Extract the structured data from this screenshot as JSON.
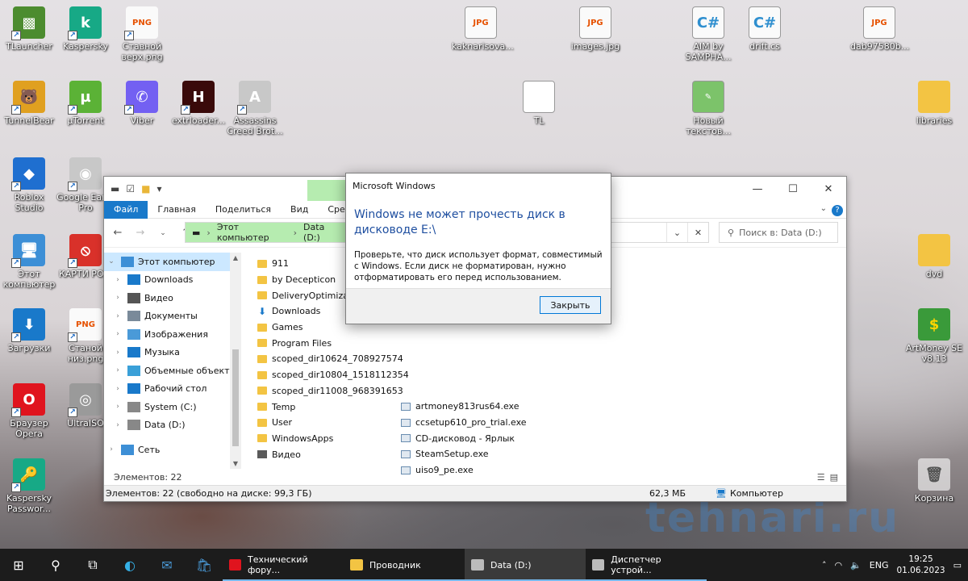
{
  "desktop_icons_left": [
    {
      "label": "TLauncher",
      "color": "#4c8c2f",
      "glyph": "▩"
    },
    {
      "label": "Kaspersky",
      "color": "#17a986",
      "glyph": "k"
    },
    {
      "label": "Ставной верх.png",
      "color": "#fafafa",
      "glyph": "PNG"
    },
    {
      "label": "TunnelBear",
      "color": "#e0a020",
      "glyph": "🐻"
    },
    {
      "label": "µTorrent",
      "color": "#5bb236",
      "glyph": "µ"
    },
    {
      "label": "Viber",
      "color": "#7360f2",
      "glyph": "✆"
    },
    {
      "label": "extrloader...",
      "color": "#3a0a0a",
      "glyph": "H"
    },
    {
      "label": "Assassins Creed Brot...",
      "color": "#c8c8c8",
      "glyph": "A"
    },
    {
      "label": "Roblox Studio",
      "color": "#1f6fd0",
      "glyph": "◆"
    },
    {
      "label": "Google Earth Pro",
      "color": "#c8c8c8",
      "glyph": "◉"
    },
    {
      "label": "Этот компьютер",
      "color": "#3d8fd6",
      "glyph": "🖥"
    },
    {
      "label": "КАРТИ РО...",
      "color": "#d9312a",
      "glyph": "⦸"
    },
    {
      "label": "Загрузки",
      "color": "#1979ca",
      "glyph": "⬇"
    },
    {
      "label": "Станой низ.png",
      "color": "#fafafa",
      "glyph": "PNG"
    },
    {
      "label": "Браузер Opera",
      "color": "#e0141e",
      "glyph": "O"
    },
    {
      "label": "UltraISO",
      "color": "#9a9a9a",
      "glyph": "◎"
    },
    {
      "label": "Kaspersky Passwor...",
      "color": "#17a986",
      "glyph": "🔑"
    }
  ],
  "desktop_icons_top": [
    {
      "label": "kaknarisova...",
      "kind": "file",
      "glyph": "JPG"
    },
    {
      "label": "images.jpg",
      "kind": "file",
      "glyph": "JPG"
    },
    {
      "label": "AIM by SAMPHA...",
      "kind": "cs",
      "glyph": "C#"
    },
    {
      "label": "drift.cs",
      "kind": "cs",
      "glyph": "C#"
    },
    {
      "label": "dab97580b...",
      "kind": "file",
      "glyph": "JPG"
    },
    {
      "label": "TL",
      "kind": "blank",
      "glyph": ""
    },
    {
      "label": "Новый текстов...",
      "kind": "note",
      "glyph": "✎"
    },
    {
      "label": "libraries",
      "kind": "folder",
      "glyph": ""
    }
  ],
  "desktop_icons_right": [
    {
      "label": "dvd",
      "kind": "folder",
      "glyph": ""
    },
    {
      "label": "ArtMoney SE v8.13",
      "kind": "app",
      "glyph": "$"
    },
    {
      "label": "Корзина",
      "kind": "bin",
      "glyph": "🗑"
    }
  ],
  "explorer": {
    "ribbon_tabs": [
      "Файл",
      "Главная",
      "Поделиться",
      "Вид",
      "Средст"
    ],
    "breadcrumb": [
      "Этот компьютер",
      "Data (D:)"
    ],
    "search_placeholder": "Поиск в: Data (D:)",
    "nav_items": [
      {
        "label": "Этот компьютер",
        "selected": true,
        "indent": 0,
        "icon": "#3d8fd6"
      },
      {
        "label": "Downloads",
        "selected": false,
        "indent": 1,
        "icon": "#1979ca"
      },
      {
        "label": "Видео",
        "selected": false,
        "indent": 1,
        "icon": "#555555"
      },
      {
        "label": "Документы",
        "selected": false,
        "indent": 1,
        "icon": "#7a8a9a"
      },
      {
        "label": "Изображения",
        "selected": false,
        "indent": 1,
        "icon": "#4a9ad8"
      },
      {
        "label": "Музыка",
        "selected": false,
        "indent": 1,
        "icon": "#1979ca"
      },
      {
        "label": "Объемные объекты",
        "selected": false,
        "indent": 1,
        "icon": "#3aa0d8"
      },
      {
        "label": "Рабочий стол",
        "selected": false,
        "indent": 1,
        "icon": "#1979ca"
      },
      {
        "label": "System (C:)",
        "selected": false,
        "indent": 1,
        "icon": "#888888"
      },
      {
        "label": "Data (D:)",
        "selected": false,
        "indent": 1,
        "icon": "#888888"
      },
      {
        "label": "Сеть",
        "selected": false,
        "indent": 0,
        "icon": "#3d8fd6"
      }
    ],
    "files_col1": [
      {
        "name": "911",
        "type": "folder"
      },
      {
        "name": "by Decepticon",
        "type": "folder"
      },
      {
        "name": "DeliveryOptimization",
        "type": "folder"
      },
      {
        "name": "Downloads",
        "type": "download"
      },
      {
        "name": "Games",
        "type": "folder"
      },
      {
        "name": "Program Files",
        "type": "folder"
      },
      {
        "name": "scoped_dir10624_708927574",
        "type": "folder"
      },
      {
        "name": "scoped_dir10804_1518112354",
        "type": "folder"
      },
      {
        "name": "scoped_dir11008_968391653",
        "type": "folder"
      },
      {
        "name": "Temp",
        "type": "folder"
      },
      {
        "name": "User",
        "type": "folder"
      },
      {
        "name": "WindowsApps",
        "type": "folder"
      },
      {
        "name": "Видео",
        "type": "video"
      }
    ],
    "files_col2": [
      {
        "name": "artmoney813rus64.exe",
        "type": "exe"
      },
      {
        "name": "ccsetup610_pro_trial.exe",
        "type": "exe"
      },
      {
        "name": "CD-дисковод - Ярлык",
        "type": "exe"
      },
      {
        "name": "SteamSetup.exe",
        "type": "exe"
      },
      {
        "name": "uiso9_pe.exe",
        "type": "exe"
      }
    ],
    "items_count": "Элементов: 22",
    "status_left": "Элементов: 22 (свободно на диске: 99,3 ГБ)",
    "status_size": "62,3 МБ",
    "status_location": "Компьютер"
  },
  "dialog": {
    "title": "Microsoft Windows",
    "heading": "Windows не может прочесть диск в дисководе E:\\",
    "body": "Проверьте, что диск использует формат, совместимый с Windows. Если диск не форматирован, нужно отформатировать его перед использованием.",
    "button": "Закрыть"
  },
  "taskbar": {
    "apps": [
      {
        "label": "Технический фору...",
        "color": "#e0141e",
        "active": false
      },
      {
        "label": "Проводник",
        "color": "#f3c443",
        "active": false
      },
      {
        "label": "Data (D:)",
        "color": "#bbbbbb",
        "active": true
      },
      {
        "label": "Диспетчер устрой...",
        "color": "#bbbbbb",
        "active": false
      }
    ],
    "lang": "ENG",
    "time": "19:25",
    "date": "01.06.2023"
  },
  "watermark": "tehnari.ru"
}
